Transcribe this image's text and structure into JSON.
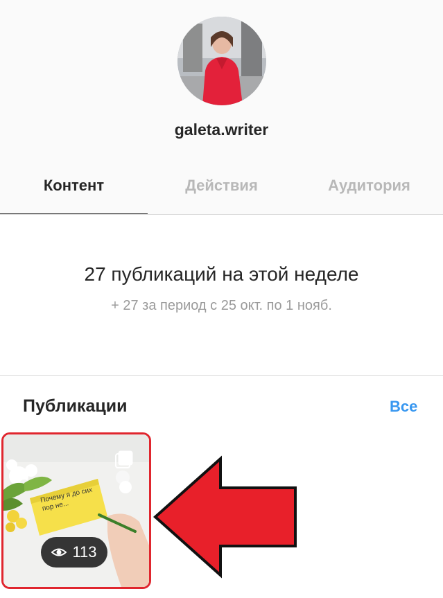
{
  "profile": {
    "username": "galeta.writer"
  },
  "tabs": [
    {
      "label": "Контент",
      "active": true
    },
    {
      "label": "Действия",
      "active": false
    },
    {
      "label": "Аудитория",
      "active": false
    }
  ],
  "summary": {
    "title": "27 публикаций на этой неделе",
    "subtitle": "+ 27 за период с 25 окт. по 1 нояб."
  },
  "publications": {
    "heading": "Публикации",
    "see_all": "Все",
    "posts": [
      {
        "caption": "Почему я до сих пор не...",
        "views": "113"
      }
    ]
  },
  "colors": {
    "accent_link": "#3897f0",
    "highlight": "#e0262e",
    "arrow": "#e8202a"
  }
}
